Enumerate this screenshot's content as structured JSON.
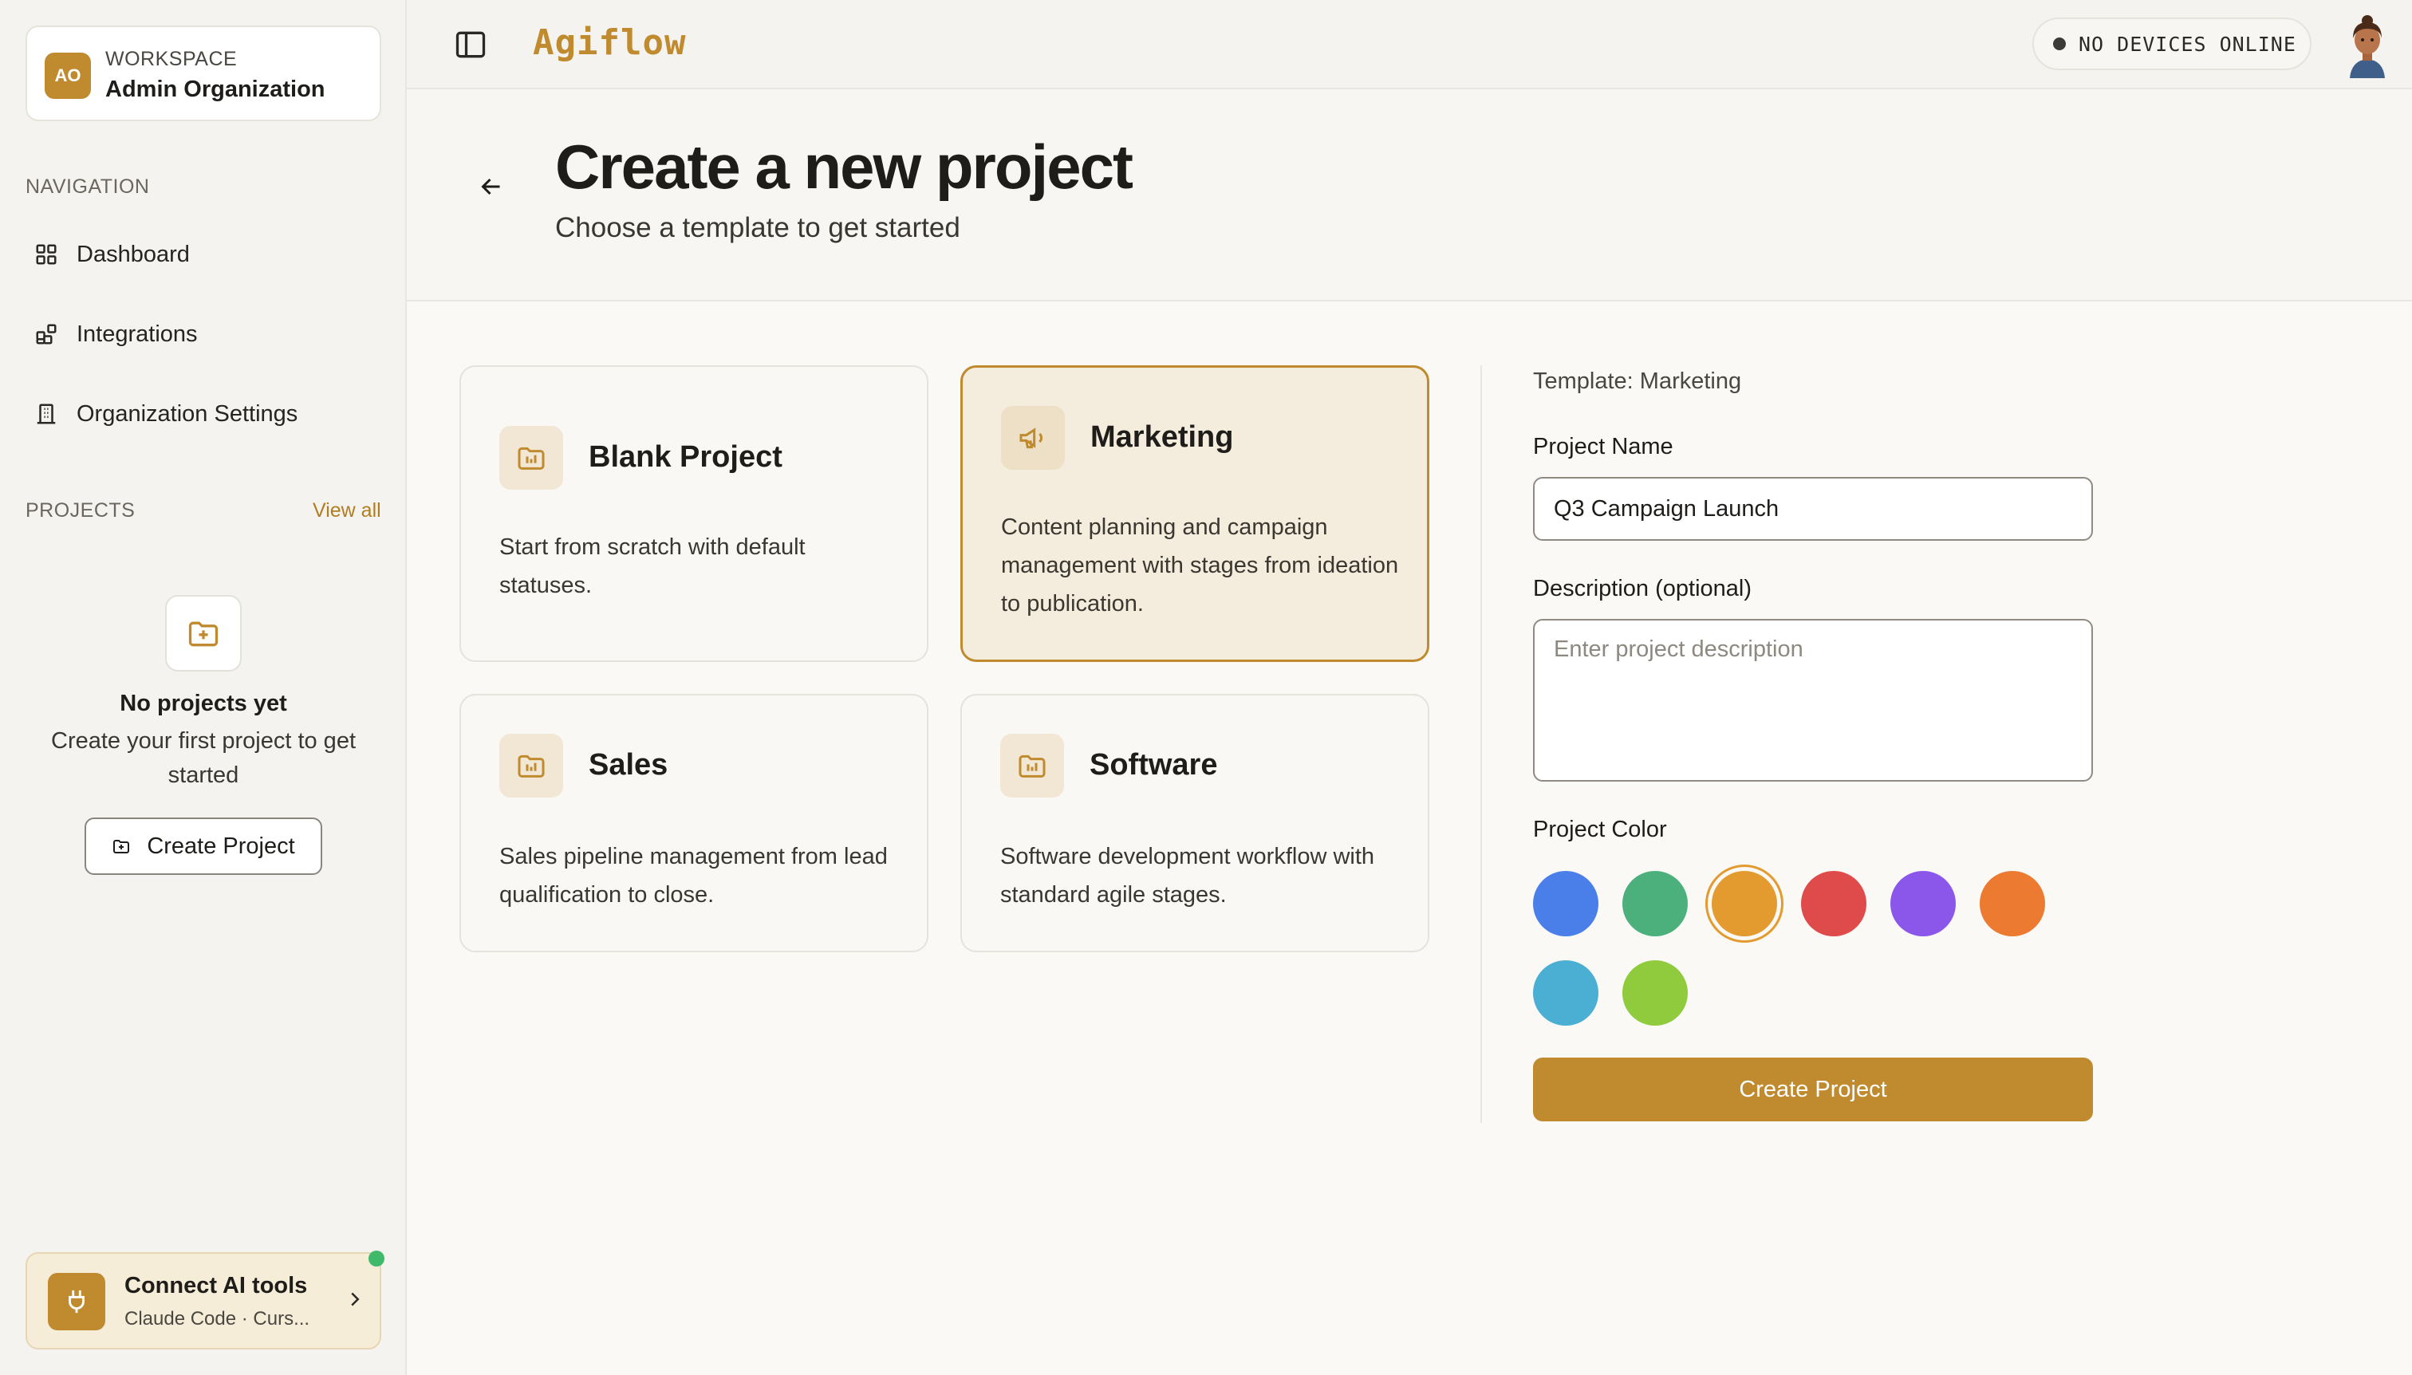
{
  "workspace": {
    "initials": "AO",
    "kicker": "WORKSPACE",
    "name": "Admin Organization"
  },
  "sidebar": {
    "nav_heading": "NAVIGATION",
    "nav": [
      {
        "label": "Dashboard",
        "icon": "grid-icon"
      },
      {
        "label": "Integrations",
        "icon": "puzzle-grid-icon"
      },
      {
        "label": "Organization Settings",
        "icon": "building-icon"
      }
    ],
    "projects_heading": "PROJECTS",
    "view_all": "View all",
    "empty": {
      "title": "No projects yet",
      "subtitle": "Create your first project to get started",
      "button": "Create Project"
    },
    "ai": {
      "title": "Connect AI tools",
      "subtitle": "Claude Code · Curs...",
      "status": "online"
    }
  },
  "topbar": {
    "brand": "Agiflow",
    "devices": "NO DEVICES ONLINE"
  },
  "header": {
    "title": "Create a new project",
    "subtitle": "Choose a template to get started"
  },
  "templates": [
    {
      "name": "Blank Project",
      "description": "Start from scratch with default statuses.",
      "icon": "folder-chart-icon",
      "selected": false
    },
    {
      "name": "Marketing",
      "description": "Content planning and campaign management with stages from ideation to publication.",
      "icon": "megaphone-icon",
      "selected": true
    },
    {
      "name": "Sales",
      "description": "Sales pipeline management from lead qualification to close.",
      "icon": "folder-chart-icon",
      "selected": false
    },
    {
      "name": "Software",
      "description": "Software development workflow with standard agile stages.",
      "icon": "folder-chart-icon",
      "selected": false
    }
  ],
  "form": {
    "template_indicator": "Template: Marketing",
    "name_label": "Project Name",
    "name_value": "Q3 Campaign Launch",
    "description_label": "Description (optional)",
    "description_placeholder": "Enter project description",
    "color_label": "Project Color",
    "colors": [
      "#4a7ee8",
      "#4cb07c",
      "#e39a2e",
      "#df4a4a",
      "#8a57ea",
      "#ec7a30",
      "#4bafd3",
      "#8fcb3d"
    ],
    "selected_color": "#e39a2e",
    "submit": "Create Project"
  },
  "colors": {
    "accent": "#c08a2e",
    "online": "#3fb96a"
  }
}
